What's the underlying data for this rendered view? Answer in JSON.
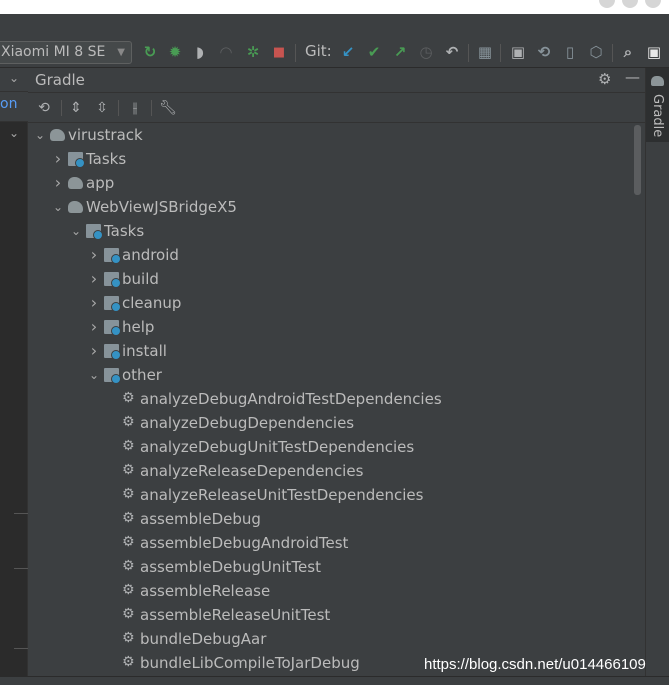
{
  "toolbar": {
    "device": "Xiaomi MI 8 SE",
    "git_label": "Git:",
    "colors": {
      "green": "#499c54",
      "red": "#c75450",
      "blue": "#3592c4",
      "gray": "#6e6e6e"
    }
  },
  "left_pane": {
    "fragment": "on"
  },
  "gradle": {
    "title": "Gradle",
    "tree": [
      {
        "label": "virustrack",
        "icon": "elephant",
        "depth": 0,
        "expanded": true
      },
      {
        "label": "Tasks",
        "icon": "folder",
        "depth": 1,
        "expanded": false
      },
      {
        "label": "app",
        "icon": "elephant",
        "depth": 1,
        "expanded": false
      },
      {
        "label": "WebViewJSBridgeX5",
        "icon": "elephant",
        "depth": 1,
        "expanded": true
      },
      {
        "label": "Tasks",
        "icon": "folder",
        "depth": 2,
        "expanded": true
      },
      {
        "label": "android",
        "icon": "folder",
        "depth": 3,
        "expanded": false
      },
      {
        "label": "build",
        "icon": "folder",
        "depth": 3,
        "expanded": false
      },
      {
        "label": "cleanup",
        "icon": "folder",
        "depth": 3,
        "expanded": false
      },
      {
        "label": "help",
        "icon": "folder",
        "depth": 3,
        "expanded": false
      },
      {
        "label": "install",
        "icon": "folder",
        "depth": 3,
        "expanded": false
      },
      {
        "label": "other",
        "icon": "folder",
        "depth": 3,
        "expanded": true
      },
      {
        "label": "analyzeDebugAndroidTestDependencies",
        "icon": "gear",
        "depth": 4
      },
      {
        "label": "analyzeDebugDependencies",
        "icon": "gear",
        "depth": 4
      },
      {
        "label": "analyzeDebugUnitTestDependencies",
        "icon": "gear",
        "depth": 4
      },
      {
        "label": "analyzeReleaseDependencies",
        "icon": "gear",
        "depth": 4
      },
      {
        "label": "analyzeReleaseUnitTestDependencies",
        "icon": "gear",
        "depth": 4
      },
      {
        "label": "assembleDebug",
        "icon": "gear",
        "depth": 4
      },
      {
        "label": "assembleDebugAndroidTest",
        "icon": "gear",
        "depth": 4
      },
      {
        "label": "assembleDebugUnitTest",
        "icon": "gear",
        "depth": 4
      },
      {
        "label": "assembleRelease",
        "icon": "gear",
        "depth": 4
      },
      {
        "label": "assembleReleaseUnitTest",
        "icon": "gear",
        "depth": 4
      },
      {
        "label": "bundleDebugAar",
        "icon": "gear",
        "depth": 4
      },
      {
        "label": "bundleLibCompileToJarDebug",
        "icon": "gear",
        "depth": 4
      }
    ]
  },
  "right_strip": {
    "tab_label": "Gradle"
  },
  "watermark": "https://blog.csdn.net/u014466109"
}
